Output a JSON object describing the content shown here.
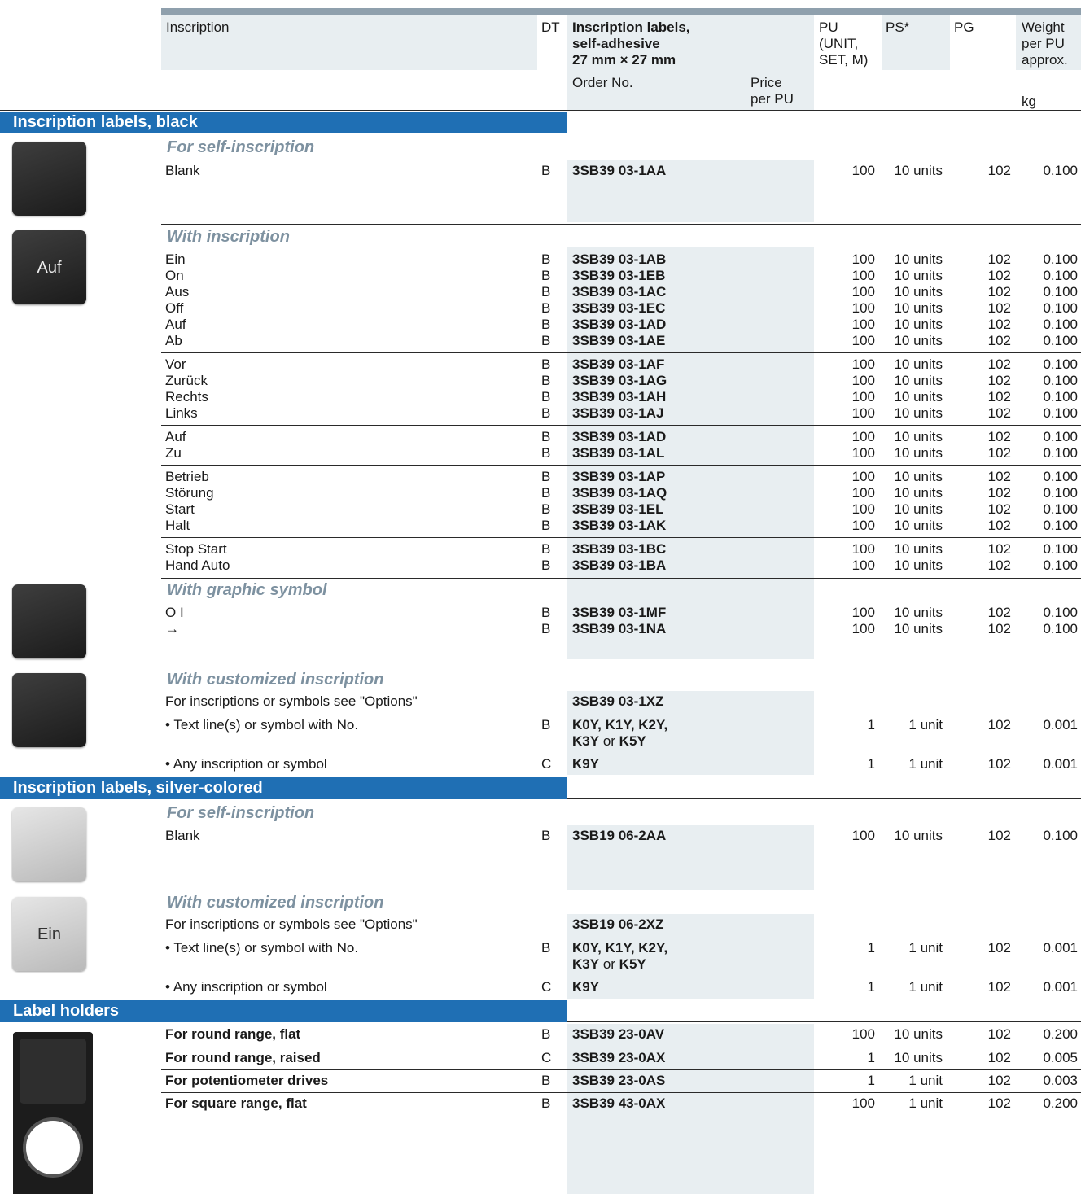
{
  "header": {
    "inscription": "Inscription",
    "dt": "DT",
    "labels_title_1": "Inscription labels,",
    "labels_title_2": "self-adhesive",
    "labels_title_3": "27 mm × 27 mm",
    "order_no": "Order No.",
    "price_1": "Price",
    "price_2": "per PU",
    "pu_1": "PU",
    "pu_2": "(UNIT,",
    "pu_3": "SET, M)",
    "ps": "PS*",
    "pg": "PG",
    "weight_1": "Weight",
    "weight_2": "per PU",
    "weight_3": "approx.",
    "kg": "kg"
  },
  "sections": {
    "black": "Inscription labels, black",
    "silver": "Inscription labels, silver-colored",
    "holders": "Label holders"
  },
  "subheads": {
    "self_black": "For self-inscription",
    "with_inscription": "With inscription",
    "graphic": "With graphic symbol",
    "custom_black": "With customized inscription",
    "self_silver": "For self-inscription",
    "custom_silver": "With customized inscription"
  },
  "swatches": {
    "auf": "Auf",
    "ein": "Ein"
  },
  "rows": [
    {
      "inscription": "Blank",
      "dt": "B",
      "order": "3SB39 03-1AA",
      "pu": "100",
      "ps": "10 units",
      "pg": "102",
      "wt": "0.100"
    },
    {
      "inscription": "Ein",
      "dt": "B",
      "order": "3SB39 03-1AB",
      "pu": "100",
      "ps": "10 units",
      "pg": "102",
      "wt": "0.100"
    },
    {
      "inscription": "On",
      "dt": "B",
      "order": "3SB39 03-1EB",
      "pu": "100",
      "ps": "10 units",
      "pg": "102",
      "wt": "0.100"
    },
    {
      "inscription": "Aus",
      "dt": "B",
      "order": "3SB39 03-1AC",
      "pu": "100",
      "ps": "10 units",
      "pg": "102",
      "wt": "0.100"
    },
    {
      "inscription": "Off",
      "dt": "B",
      "order": "3SB39 03-1EC",
      "pu": "100",
      "ps": "10 units",
      "pg": "102",
      "wt": "0.100"
    },
    {
      "inscription": "Auf",
      "dt": "B",
      "order": "3SB39 03-1AD",
      "pu": "100",
      "ps": "10 units",
      "pg": "102",
      "wt": "0.100"
    },
    {
      "inscription": "Ab",
      "dt": "B",
      "order": "3SB39 03-1AE",
      "pu": "100",
      "ps": "10 units",
      "pg": "102",
      "wt": "0.100"
    },
    {
      "inscription": "Vor",
      "dt": "B",
      "order": "3SB39 03-1AF",
      "pu": "100",
      "ps": "10 units",
      "pg": "102",
      "wt": "0.100"
    },
    {
      "inscription": "Zurück",
      "dt": "B",
      "order": "3SB39 03-1AG",
      "pu": "100",
      "ps": "10 units",
      "pg": "102",
      "wt": "0.100"
    },
    {
      "inscription": "Rechts",
      "dt": "B",
      "order": "3SB39 03-1AH",
      "pu": "100",
      "ps": "10 units",
      "pg": "102",
      "wt": "0.100"
    },
    {
      "inscription": "Links",
      "dt": "B",
      "order": "3SB39 03-1AJ",
      "pu": "100",
      "ps": "10 units",
      "pg": "102",
      "wt": "0.100"
    },
    {
      "inscription": "Auf",
      "dt": "B",
      "order": "3SB39 03-1AD",
      "pu": "100",
      "ps": "10 units",
      "pg": "102",
      "wt": "0.100"
    },
    {
      "inscription": "Zu",
      "dt": "B",
      "order": "3SB39 03-1AL",
      "pu": "100",
      "ps": "10 units",
      "pg": "102",
      "wt": "0.100"
    },
    {
      "inscription": "Betrieb",
      "dt": "B",
      "order": "3SB39 03-1AP",
      "pu": "100",
      "ps": "10 units",
      "pg": "102",
      "wt": "0.100"
    },
    {
      "inscription": "Störung",
      "dt": "B",
      "order": "3SB39 03-1AQ",
      "pu": "100",
      "ps": "10 units",
      "pg": "102",
      "wt": "0.100"
    },
    {
      "inscription": "Start",
      "dt": "B",
      "order": "3SB39 03-1EL",
      "pu": "100",
      "ps": "10 units",
      "pg": "102",
      "wt": "0.100"
    },
    {
      "inscription": "Halt",
      "dt": "B",
      "order": "3SB39 03-1AK",
      "pu": "100",
      "ps": "10 units",
      "pg": "102",
      "wt": "0.100"
    },
    {
      "inscription": "Stop Start",
      "dt": "B",
      "order": "3SB39 03-1BC",
      "pu": "100",
      "ps": "10 units",
      "pg": "102",
      "wt": "0.100"
    },
    {
      "inscription": "Hand Auto",
      "dt": "B",
      "order": "3SB39 03-1BA",
      "pu": "100",
      "ps": "10 units",
      "pg": "102",
      "wt": "0.100"
    },
    {
      "inscription": "O I",
      "dt": "B",
      "order": "3SB39 03-1MF",
      "pu": "100",
      "ps": "10 units",
      "pg": "102",
      "wt": "0.100"
    },
    {
      "inscription": "→",
      "dt": "B",
      "order": "3SB39 03-1NA",
      "pu": "100",
      "ps": "10 units",
      "pg": "102",
      "wt": "0.100"
    },
    {
      "inscription": "For inscriptions or symbols see \"Options\"",
      "dt": "",
      "order": "3SB39 03-1XZ",
      "pu": "",
      "ps": "",
      "pg": "",
      "wt": ""
    },
    {
      "inscription": "• Text line(s) or symbol with No.",
      "dt": "B",
      "order": "K0Y, K1Y, K2Y,",
      "pu": "1",
      "ps": "1 unit",
      "pg": "102",
      "wt": "0.001"
    },
    {
      "inscription": "• Any inscription or symbol",
      "dt": "C",
      "order": "K9Y",
      "pu": "1",
      "ps": "1 unit",
      "pg": "102",
      "wt": "0.001"
    },
    {
      "inscription": "Blank",
      "dt": "B",
      "order": "3SB19 06-2AA",
      "pu": "100",
      "ps": "10 units",
      "pg": "102",
      "wt": "0.100"
    },
    {
      "inscription": "For inscriptions or symbols see \"Options\"",
      "dt": "",
      "order": "3SB19 06-2XZ",
      "pu": "",
      "ps": "",
      "pg": "",
      "wt": ""
    },
    {
      "inscription": "• Text line(s) or symbol with No.",
      "dt": "B",
      "order": "K0Y, K1Y, K2Y,",
      "pu": "1",
      "ps": "1 unit",
      "pg": "102",
      "wt": "0.001"
    },
    {
      "inscription": "• Any inscription or symbol",
      "dt": "C",
      "order": "K9Y",
      "pu": "1",
      "ps": "1 unit",
      "pg": "102",
      "wt": "0.001"
    },
    {
      "inscription": "For round range, flat",
      "dt": "B",
      "order": "3SB39 23-0AV",
      "pu": "100",
      "ps": "10 units",
      "pg": "102",
      "wt": "0.200"
    },
    {
      "inscription": "For round range, raised",
      "dt": "C",
      "order": "3SB39 23-0AX",
      "pu": "1",
      "ps": "10 units",
      "pg": "102",
      "wt": "0.005"
    },
    {
      "inscription": "For potentiometer drives",
      "dt": "B",
      "order": "3SB39 23-0AS",
      "pu": "1",
      "ps": "1 unit",
      "pg": "102",
      "wt": "0.003"
    },
    {
      "inscription": "For square range, flat",
      "dt": "B",
      "order": "3SB39 43-0AX",
      "pu": "100",
      "ps": "1 unit",
      "pg": "102",
      "wt": "0.200"
    }
  ],
  "order_second_line": {
    "k3y": "K3Y",
    "or": "or",
    "k5y": "K5Y"
  }
}
